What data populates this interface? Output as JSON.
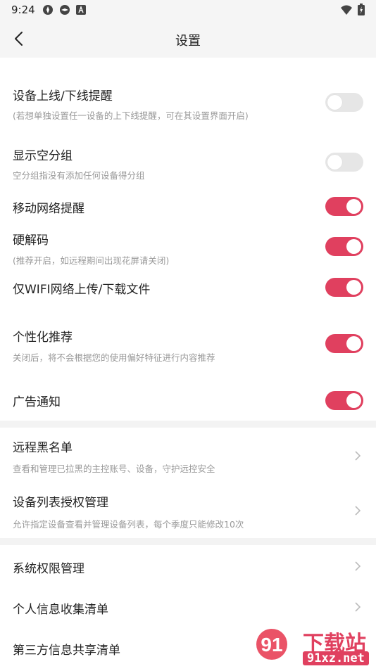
{
  "status_bar": {
    "time": "9:24",
    "icons": [
      "vpn-icon",
      "vpn-icon",
      "app-notification-icon",
      "wifi-icon",
      "battery-icon"
    ]
  },
  "header": {
    "title": "设置",
    "back_icon": "back-arrow-icon"
  },
  "settings": [
    {
      "label": "设备上线/下线提醒",
      "sub": "(若想单独设置任一设备的上下线提醒，可在其设置界面开启)",
      "toggle": false
    },
    {
      "label": "显示空分组",
      "sub": "空分组指没有添加任何设备得分组",
      "toggle": false
    },
    {
      "label": "移动网络提醒",
      "toggle": true
    },
    {
      "label": "硬解码",
      "sub": "(推荐开启，如远程期间出现花屏请关闭)",
      "toggle": true
    },
    {
      "label": "仅WIFI网络上传/下载文件",
      "toggle": true
    },
    {
      "label": "个性化推荐",
      "sub": "关闭后，将不会根据您的使用偏好特征进行内容推荐",
      "toggle": true
    },
    {
      "label": "广告通知",
      "toggle": true
    }
  ],
  "nav_section_1": [
    {
      "label": "远程黑名单",
      "sub": "查看和管理已拉黑的主控账号、设备，守护远控安全"
    },
    {
      "label": "设备列表授权管理",
      "sub": "允许指定设备查看并管理设备列表，每个季度只能修改10次"
    }
  ],
  "nav_section_2": [
    {
      "label": "系统权限管理"
    },
    {
      "label": "个人信息收集清单"
    },
    {
      "label": "第三方信息共享清单"
    }
  ],
  "watermark": {
    "main": "下载站",
    "domain": "91xz.net"
  },
  "colors": {
    "accent": "#e0405f",
    "toggle_off": "#e6e6e6",
    "subtext": "#999999",
    "header_bg": "#f5f5f5"
  }
}
